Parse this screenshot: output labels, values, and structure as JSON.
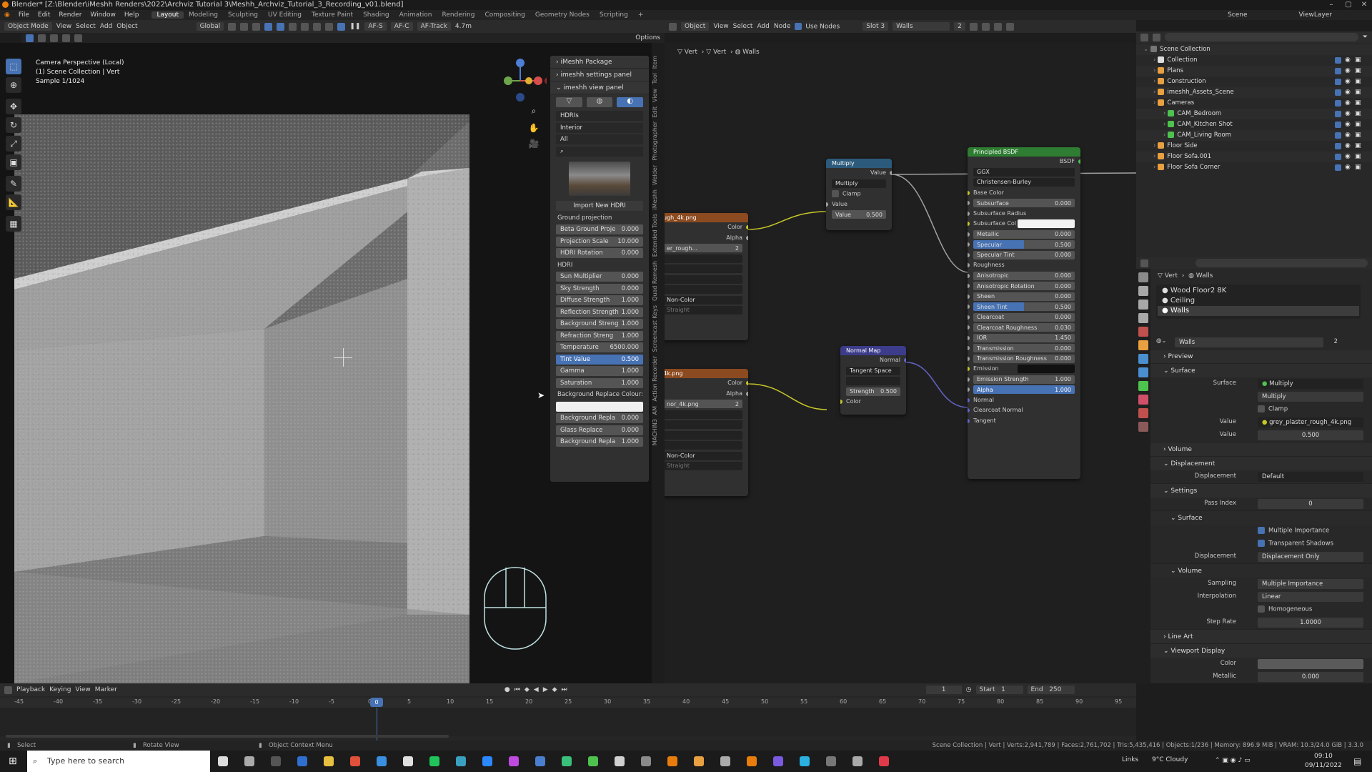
{
  "title_bar": {
    "text": "Blender* [Z:\\Blender\\iMeshh Renders\\2022\\Archviz Tutorial 3\\Meshh_Archviz_Tutorial_3_Recording_v01.blend]"
  },
  "menu": [
    "File",
    "Edit",
    "Render",
    "Window",
    "Help"
  ],
  "workspaces": [
    "Layout",
    "Modeling",
    "Sculpting",
    "UV Editing",
    "Texture Paint",
    "Shading",
    "Animation",
    "Rendering",
    "Compositing",
    "Geometry Nodes",
    "Scripting"
  ],
  "scene": "Scene",
  "view_layer": "ViewLayer",
  "viewport": {
    "mode": "Object Mode",
    "menus": [
      "View",
      "Select",
      "Add",
      "Object"
    ],
    "orientation": "Global",
    "af_s": "AF-S",
    "af_c": "AF-C",
    "af_track": "AF-Track",
    "focal": "4.7m",
    "options": "Options",
    "overlay": [
      "Camera Perspective (Local)",
      "(1) Scene Collection | Vert",
      "Sample 1/1024"
    ]
  },
  "npanel": {
    "headers": [
      "iMeshh Package",
      "imeshh settings panel",
      "imeshh view panel"
    ],
    "dropdowns": [
      "HDRIs",
      "Interior",
      "All"
    ],
    "import_label": "Import New HDRI",
    "ground_label": "Ground projection",
    "ground": [
      {
        "k": "Beta Ground Proje",
        "v": "0.000"
      },
      {
        "k": "Projection Scale",
        "v": "10.000"
      },
      {
        "k": "HDRI Rotation",
        "v": "0.000"
      }
    ],
    "hdri_label": "HDRI",
    "hdri": [
      {
        "k": "Sun Multiplier",
        "v": "0.000"
      },
      {
        "k": "Sky Strength",
        "v": "0.000"
      },
      {
        "k": "Diffuse Strength",
        "v": "1.000"
      },
      {
        "k": "Reflection Strength",
        "v": "1.000"
      },
      {
        "k": "Background Streng",
        "v": "1.000"
      },
      {
        "k": "Refraction Streng",
        "v": "1.000"
      },
      {
        "k": "Temperature",
        "v": "6500.000"
      },
      {
        "k": "Tint Value",
        "v": "0.500",
        "hl": true
      },
      {
        "k": "Gamma",
        "v": "1.000"
      },
      {
        "k": "Saturation",
        "v": "1.000"
      }
    ],
    "bg_label": "Background Replace Colour:",
    "bg": [
      {
        "k": "Background Repla",
        "v": "0.000"
      },
      {
        "k": "Glass Replace",
        "v": "0.000"
      },
      {
        "k": "Background Repla",
        "v": "1.000"
      }
    ]
  },
  "side_tabs": [
    "Item",
    "Tool",
    "View",
    "Edit",
    "Photographer",
    "Welder",
    "iMeshh",
    "Extended Tools",
    "Quad Remesh",
    "Screencast Keys",
    "Action Recorder",
    "AM",
    "MACHIN3"
  ],
  "node_editor": {
    "breadcrumb": [
      "Vert",
      "Vert",
      "Walls"
    ],
    "menus": [
      "Object",
      "View",
      "Select",
      "Add",
      "Node"
    ],
    "use_nodes": "Use Nodes",
    "slot": "Slot 3",
    "material": "Walls",
    "users": "2",
    "tex1": {
      "name": "ugh_4k.png",
      "field": "er_rough...",
      "users": "2",
      "color": "Color",
      "alpha": "Alpha",
      "colorspace": "Non-Color",
      "alpha_mode": "Straight"
    },
    "tex2": {
      "name": "4k.png",
      "field": "nor_4k.png",
      "users": "2",
      "color": "Color",
      "alpha": "Alpha",
      "colorspace": "Non-Color",
      "alpha_mode": "Straight"
    },
    "multiply": {
      "title": "Multiply",
      "out": "Value",
      "op": "Multiply",
      "clamp": "Clamp",
      "in": "Value",
      "field_k": "Value",
      "field_v": "0.500"
    },
    "normal_map": {
      "title": "Normal Map",
      "out": "Normal",
      "space": "Tangent Space",
      "strength_k": "Strength",
      "strength_v": "0.500",
      "in": "Color"
    },
    "bsdf": {
      "title": "Principled BSDF",
      "out": "BSDF",
      "dist": "GGX",
      "sss": "Christensen-Burley",
      "rows": [
        {
          "k": "Base Color",
          "t": "label"
        },
        {
          "k": "Subsurface",
          "v": "0.000"
        },
        {
          "k": "Subsurface Radius",
          "t": "label"
        },
        {
          "k": "Subsurface Col",
          "t": "color"
        },
        {
          "k": "Metallic",
          "v": "0.000"
        },
        {
          "k": "Specular",
          "v": "0.500",
          "t": "bar"
        },
        {
          "k": "Specular Tint",
          "v": "0.000"
        },
        {
          "k": "Roughness",
          "t": "label"
        },
        {
          "k": "Anisotropic",
          "v": "0.000"
        },
        {
          "k": "Anisotropic Rotation",
          "v": "0.000"
        },
        {
          "k": "Sheen",
          "v": "0.000"
        },
        {
          "k": "Sheen Tint",
          "v": "0.500",
          "t": "bar"
        },
        {
          "k": "Clearcoat",
          "v": "0.000"
        },
        {
          "k": "Clearcoat Roughness",
          "v": "0.030"
        },
        {
          "k": "IOR",
          "v": "1.450"
        },
        {
          "k": "Transmission",
          "v": "0.000"
        },
        {
          "k": "Transmission Roughness",
          "v": "0.000"
        },
        {
          "k": "Emission",
          "t": "dark"
        },
        {
          "k": "Emission Strength",
          "v": "1.000"
        },
        {
          "k": "Alpha",
          "v": "1.000",
          "t": "hl"
        },
        {
          "k": "Normal",
          "t": "label"
        },
        {
          "k": "Clearcoat Normal",
          "t": "label"
        },
        {
          "k": "Tangent",
          "t": "label"
        }
      ]
    }
  },
  "outliner": {
    "rows": [
      {
        "n": "Scene Collection",
        "d": 0
      },
      {
        "n": "Collection",
        "d": 1
      },
      {
        "n": "Plans",
        "d": 1
      },
      {
        "n": "Construction",
        "d": 1
      },
      {
        "n": "imeshh_Assets_Scene",
        "d": 1
      },
      {
        "n": "Cameras",
        "d": 1
      },
      {
        "n": "CAM_Bedroom",
        "d": 2
      },
      {
        "n": "CAM_Kitchen Shot",
        "d": 2
      },
      {
        "n": "CAM_Living Room",
        "d": 2
      },
      {
        "n": "Floor Side",
        "d": 1
      },
      {
        "n": "Floor Sofa.001",
        "d": 1
      },
      {
        "n": "Floor Sofa Corner",
        "d": 1
      }
    ]
  },
  "properties": {
    "breadcrumb": [
      "Vert",
      "Walls"
    ],
    "slots": [
      "Wood Floor2 8K",
      "Ceiling",
      "Walls"
    ],
    "material": "Walls",
    "users": "2",
    "preview": "Preview",
    "surface_sec": "Surface",
    "surface": {
      "label": "Surface",
      "val": "Multiply",
      "op": "Multiply",
      "clamp": "Clamp",
      "value_k": "Value",
      "value_v": "grey_plaster_rough_4k.png",
      "value2_k": "Value",
      "value2_v": "0.500"
    },
    "volume": "Volume",
    "displacement_sec": "Displacement",
    "displacement": {
      "k": "Displacement",
      "v": "Default"
    },
    "settings": "Settings",
    "pass_index": {
      "k": "Pass Index",
      "v": "0"
    },
    "surface_sub": "Surface",
    "mi": "Multiple Importance",
    "ts": "Transparent Shadows",
    "disp_method": {
      "k": "Displacement",
      "v": "Displacement Only"
    },
    "volume_sub": "Volume",
    "sampling": {
      "k": "Sampling",
      "v": "Multiple Importance"
    },
    "interp": {
      "k": "Interpolation",
      "v": "Linear"
    },
    "homog": "Homogeneous",
    "step": {
      "k": "Step Rate",
      "v": "1.0000"
    },
    "lineart": "Line Art",
    "vpdisplay": "Viewport Display",
    "color": {
      "k": "Color"
    },
    "metallic": {
      "k": "Metallic",
      "v": "0.000"
    }
  },
  "timeline": {
    "menus": [
      "Playback",
      "Keying",
      "View",
      "Marker"
    ],
    "frame": "1",
    "start_k": "Start",
    "start_v": "1",
    "end_k": "End",
    "end_v": "250",
    "current": "0",
    "ticks": [
      "-45",
      "-40",
      "-35",
      "-30",
      "-25",
      "-20",
      "-15",
      "-10",
      "-5",
      "0",
      "5",
      "10",
      "15",
      "20",
      "25",
      "30",
      "35",
      "40",
      "45",
      "50",
      "55",
      "60",
      "65",
      "70",
      "75",
      "80",
      "85",
      "90",
      "95"
    ]
  },
  "status": {
    "select": "Select",
    "rotate": "Rotate View",
    "context": "Object Context Menu",
    "stats": "Scene Collection | Vert | Verts:2,941,789 | Faces:2,761,702 | Tris:5,435,416 | Objects:1/236 | Memory: 896.9 MiB | VRAM: 10.3/24.0 GiB | 3.3.0"
  },
  "taskbar": {
    "search": "Type here to search",
    "links": "Links",
    "weather": "9°C  Cloudy",
    "time": "09:10",
    "date": "09/11/2022"
  },
  "colors": {
    "accent": "#4772b3",
    "tex_header": "#8b4a1f",
    "math_header": "#2c5a7a",
    "shader_header": "#2e7d32",
    "vector_header": "#3c3c8a"
  }
}
